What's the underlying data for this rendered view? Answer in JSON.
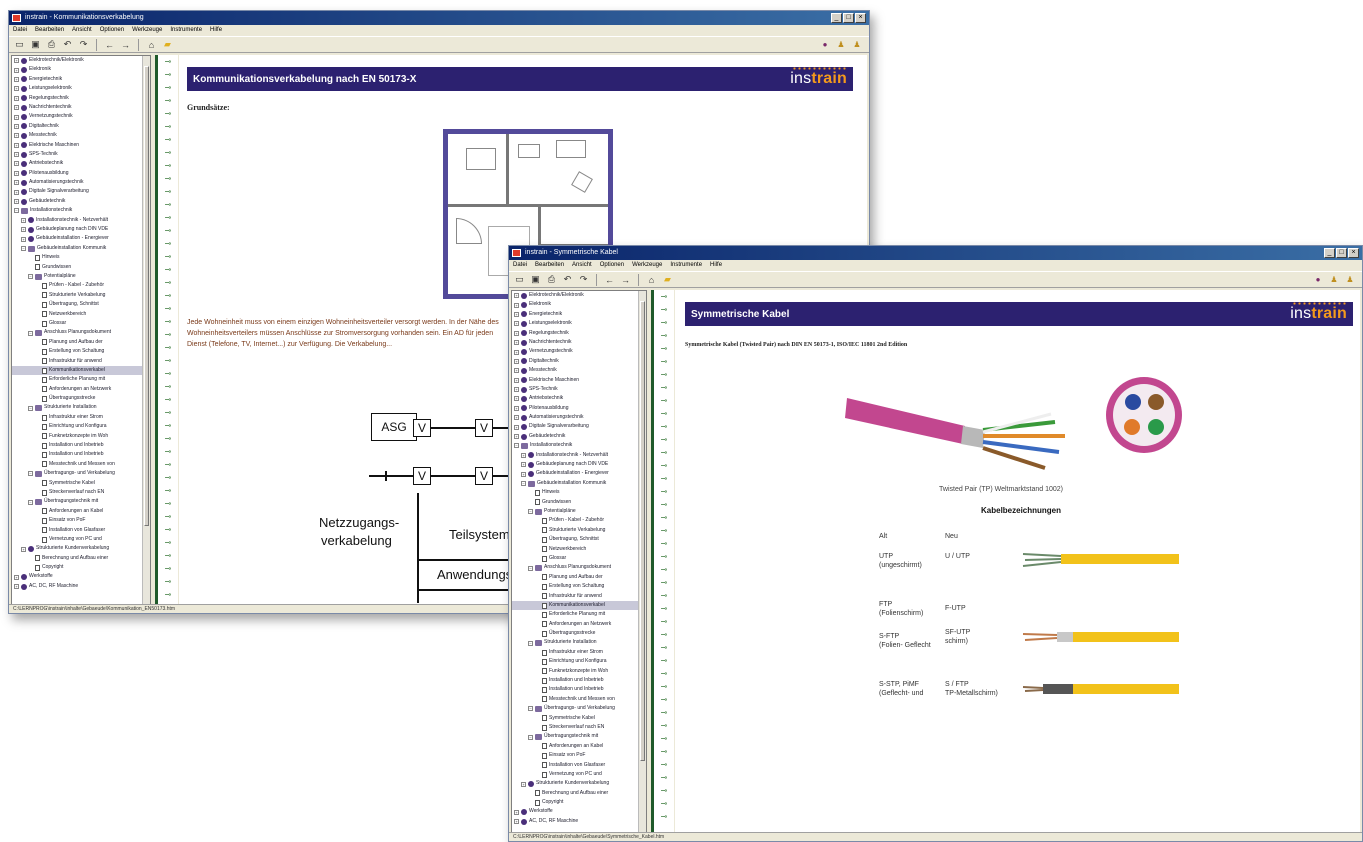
{
  "windows": [
    {
      "title": "instrain - Kommunikationsverkabelung",
      "menu": [
        "Datei",
        "Bearbeiten",
        "Ansicht",
        "Optionen",
        "Werkzeuge",
        "Instrumente",
        "Hilfe"
      ],
      "tree": [
        {
          "label": "Elektrotechnik/Elektronik",
          "indent": 0,
          "icon": "circle"
        },
        {
          "label": "Elektronik",
          "indent": 0,
          "icon": "circle"
        },
        {
          "label": "Energietechnik",
          "indent": 0,
          "icon": "circle"
        },
        {
          "label": "Leistungselektronik",
          "indent": 0,
          "icon": "circle"
        },
        {
          "label": "Regelungstechnik",
          "indent": 0,
          "icon": "circle"
        },
        {
          "label": "Nachrichtentechnik",
          "indent": 0,
          "icon": "circle"
        },
        {
          "label": "Vernetzungstechnik",
          "indent": 0,
          "icon": "circle"
        },
        {
          "label": "Digitaltechnik",
          "indent": 0,
          "icon": "circle"
        },
        {
          "label": "Messtechnik",
          "indent": 0,
          "icon": "circle"
        },
        {
          "label": "Elektrische Maschinen",
          "indent": 0,
          "icon": "circle"
        },
        {
          "label": "SPS-Technik",
          "indent": 0,
          "icon": "circle"
        },
        {
          "label": "Antriebstechnik",
          "indent": 0,
          "icon": "circle"
        },
        {
          "label": "Pilotenausbildung",
          "indent": 0,
          "icon": "circle"
        },
        {
          "label": "Automatisierungstechnik",
          "indent": 0,
          "icon": "circle"
        },
        {
          "label": "Digitale Signalverarbeitung",
          "indent": 0,
          "icon": "circle"
        },
        {
          "label": "Gebäudetechnik",
          "indent": 0,
          "icon": "circle"
        },
        {
          "label": "Installationstechnik",
          "indent": 0,
          "icon": "book"
        },
        {
          "label": "Installationstechnik - Netzverhält",
          "indent": 1,
          "icon": "circle"
        },
        {
          "label": "Gebäudeplanung nach DIN VDE",
          "indent": 1,
          "icon": "circle"
        },
        {
          "label": "Gebäudeinstallation - Energiever",
          "indent": 1,
          "icon": "circle"
        },
        {
          "label": "Gebäudeinstallation Kommunik",
          "indent": 1,
          "icon": "book"
        },
        {
          "label": "Hinweis",
          "indent": 2,
          "icon": "page"
        },
        {
          "label": "Grundwissen",
          "indent": 2,
          "icon": "page"
        },
        {
          "label": "Potentialpläne",
          "indent": 2,
          "icon": "book"
        },
        {
          "label": "Prüfen - Kabel - Zubehör",
          "indent": 3,
          "icon": "page"
        },
        {
          "label": "Strukturierte Verkabelung",
          "indent": 3,
          "icon": "page"
        },
        {
          "label": "Übertragung, Schnittst",
          "indent": 3,
          "icon": "page"
        },
        {
          "label": "Netzwerkbereich",
          "indent": 3,
          "icon": "page"
        },
        {
          "label": "Glossar",
          "indent": 3,
          "icon": "page"
        },
        {
          "label": "Anschluss Planungsdokument",
          "indent": 2,
          "icon": "book"
        },
        {
          "label": "Planung und Aufbau der",
          "indent": 3,
          "icon": "page"
        },
        {
          "label": "Erstellung von Schaltung",
          "indent": 3,
          "icon": "page"
        },
        {
          "label": "Infrastruktur für anwend",
          "indent": 3,
          "icon": "page"
        },
        {
          "label": "Kommunikationsverkabel",
          "indent": 3,
          "icon": "page",
          "selected": true
        },
        {
          "label": "Erforderliche Planung mit",
          "indent": 3,
          "icon": "page"
        },
        {
          "label": "Anforderungen an Netzwerk",
          "indent": 3,
          "icon": "page"
        },
        {
          "label": "Übertragungsstrecke",
          "indent": 3,
          "icon": "page"
        },
        {
          "label": "Strukturierte Installation",
          "indent": 2,
          "icon": "book"
        },
        {
          "label": "Infrastruktur einer Strom",
          "indent": 3,
          "icon": "page"
        },
        {
          "label": "Einrichtung und Konfigura",
          "indent": 3,
          "icon": "page"
        },
        {
          "label": "Funknetzkonzepte im Woh",
          "indent": 3,
          "icon": "page"
        },
        {
          "label": "Installation und Inbetrieb",
          "indent": 3,
          "icon": "page"
        },
        {
          "label": "Installation und Inbetrieb",
          "indent": 3,
          "icon": "page"
        },
        {
          "label": "Messtechnik und Messen von",
          "indent": 3,
          "icon": "page"
        },
        {
          "label": "Übertragungs- und Verkabelung",
          "indent": 2,
          "icon": "book"
        },
        {
          "label": "Symmetrische Kabel",
          "indent": 3,
          "icon": "page"
        },
        {
          "label": "Streckenverlauf nach EN",
          "indent": 3,
          "icon": "page"
        },
        {
          "label": "Übertragungstechnik mit",
          "indent": 2,
          "icon": "book"
        },
        {
          "label": "Anforderungen an Kabel",
          "indent": 3,
          "icon": "page"
        },
        {
          "label": "Einsatz von PoF",
          "indent": 3,
          "icon": "page"
        },
        {
          "label": "Installation von Glasfaser",
          "indent": 3,
          "icon": "page"
        },
        {
          "label": "Vernetzung von PC und",
          "indent": 3,
          "icon": "page"
        },
        {
          "label": "Strukturierte Kundenverkabelung",
          "indent": 1,
          "icon": "circle"
        },
        {
          "label": "Berechnung und Aufbau einer",
          "indent": 2,
          "icon": "page"
        },
        {
          "label": "Copyright",
          "indent": 2,
          "icon": "page"
        },
        {
          "label": "Werkstoffe",
          "indent": 0,
          "icon": "circle"
        },
        {
          "label": "AC, DC, RF Maschine",
          "indent": 0,
          "icon": "circle"
        }
      ],
      "page": {
        "banner_title": "Kommunikationsverkabelung nach EN 50173-X",
        "brand_a": "ins",
        "brand_b": "train",
        "section": "Grundsätze:",
        "paragraph": "Jede Wohneinheit muss von einem einzigen Wohneinheitsverteiler versorgt werden. In der Nähe des Wohneinheitsverteilers müssen Anschlüsse zur Stromversorgung vorhanden sein. Ein AD für jeden Dienst (Telefone, TV, Internet...) zur Verfügung. Die Verkabelung...",
        "diagram": {
          "wv": "WV",
          "asg": "ASG",
          "v": "V",
          "netz_line1": "Netzzugangs-",
          "netz_line2": "verkabelung",
          "teilsystem": "Teilsystem",
          "anwendung": "Anwendungs"
        }
      },
      "status": "C:\\LERNPROG\\instrain\\inhalte\\Gebaeude\\Kommunikation_EN50173.htm"
    },
    {
      "title": "instrain - Symmetrische Kabel",
      "menu": [
        "Datei",
        "Bearbeiten",
        "Ansicht",
        "Optionen",
        "Werkzeuge",
        "Instrumente",
        "Hilfe"
      ],
      "page": {
        "banner_title": "Symmetrische Kabel",
        "brand_a": "ins",
        "brand_b": "train",
        "subtitle": "Symmetrische Kabel (Twisted Pair) nach DIN EN 50173-1, ISO/IEC 11801 2nd Edition",
        "photo_caption": "Twisted Pair (TP) Weltmarktstand 1002)",
        "kabel_title": "Kabelbezeichnungen",
        "head_alt": "Alt",
        "head_neu": "Neu",
        "rows": [
          {
            "alt": "UTP\n(ungeschirmt)",
            "neu": "U / UTP"
          },
          {
            "alt": "FTP\n(Folienschirm)",
            "neu": "F-UTP"
          },
          {
            "alt": "S-FTP\n(Folien- Geflecht",
            "neu": "SF-UTP\nschirm)"
          },
          {
            "alt": "S-STP, PiMF\n(Geflecht- und",
            "neu": "S / FTP\nTP-Metallschirm)"
          }
        ]
      },
      "status": "C:\\LERNPROG\\instrain\\inhalte\\Gebaeude\\Symmetrische_Kabel.htm"
    }
  ],
  "colors": {
    "banner": "#2c2170",
    "brand_accent": "#f39a1c",
    "tree_icon": "#4a2f7a",
    "splitter": "#1f5a2a",
    "title_gradient_start": "#0a246a",
    "title_gradient_end": "#3a6ea5"
  },
  "icons": {
    "toolbar": [
      "new-icon",
      "save-icon",
      "print-icon",
      "back-icon",
      "forward-icon",
      "left-arrow-icon",
      "right-arrow-icon",
      "home-icon",
      "folder-icon"
    ],
    "toolbar_right": [
      "settings-icon",
      "person-icon",
      "person-icon"
    ]
  }
}
